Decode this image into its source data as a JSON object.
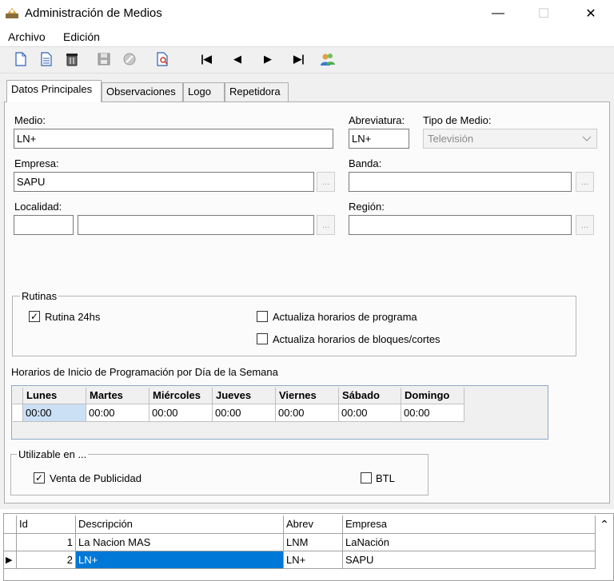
{
  "window": {
    "title": "Administración de Medios",
    "minimize": "—",
    "maximize": "☐",
    "close": "✕"
  },
  "menu": [
    "Archivo",
    "Edición"
  ],
  "toolbar": {
    "buttons": [
      "new-icon",
      "document-icon",
      "delete-icon",
      "save-icon",
      "cancel-icon",
      "search-document-icon",
      "first-icon",
      "previous-icon",
      "next-icon",
      "last-icon",
      "users-icon"
    ],
    "nav_glyphs": {
      "first": "|◀",
      "prev": "◀",
      "next": "▶",
      "last": "▶|"
    }
  },
  "tabs": [
    "Datos Principales",
    "Observaciones",
    "Logo",
    "Repetidora"
  ],
  "form": {
    "medio_label": "Medio:",
    "medio_value": "LN+",
    "abreviatura_label": "Abreviatura:",
    "abreviatura_value": "LN+",
    "tipo_label": "Tipo de Medio:",
    "tipo_value": "Televisión",
    "empresa_label": "Empresa:",
    "empresa_value": "SAPU",
    "banda_label": "Banda:",
    "banda_value": "",
    "localidad_label": "Localidad:",
    "localidad_code": "",
    "localidad_value": "",
    "region_label": "Región:",
    "region_value": "",
    "dots": "..."
  },
  "rutinas": {
    "legend": "Rutinas",
    "rutina24": {
      "label": "Rutina 24hs",
      "checked": true
    },
    "programa": {
      "label": "Actualiza horarios de programa",
      "checked": false
    },
    "bloques": {
      "label": "Actualiza horarios de bloques/cortes",
      "checked": false
    }
  },
  "horarios": {
    "title": "Horarios de Inicio de Programación por Día de la Semana",
    "columns": [
      "Lunes",
      "Martes",
      "Miércoles",
      "Jueves",
      "Viernes",
      "Sábado",
      "Domingo"
    ],
    "values": [
      "00:00",
      "00:00",
      "00:00",
      "00:00",
      "00:00",
      "00:00",
      "00:00"
    ]
  },
  "utilizable": {
    "legend": "Utilizable en ...",
    "venta": {
      "label": "Venta de Publicidad",
      "checked": true
    },
    "btl": {
      "label": "BTL",
      "checked": false
    }
  },
  "grid": {
    "columns": [
      "Id",
      "Descripción",
      "Abrev",
      "Empresa"
    ],
    "rows": [
      {
        "id": "1",
        "desc": "La Nacion MAS",
        "abrev": "LNM",
        "empresa": "LaNación"
      },
      {
        "id": "2",
        "desc": "LN+",
        "abrev": "LN+",
        "empresa": "SAPU"
      }
    ],
    "current_row_marker": "▶",
    "scroll_up": "⌃"
  },
  "colors": {
    "selection": "#0078d7",
    "cell_highlight": "#cce0f5",
    "panel": "#f0f0f0"
  }
}
